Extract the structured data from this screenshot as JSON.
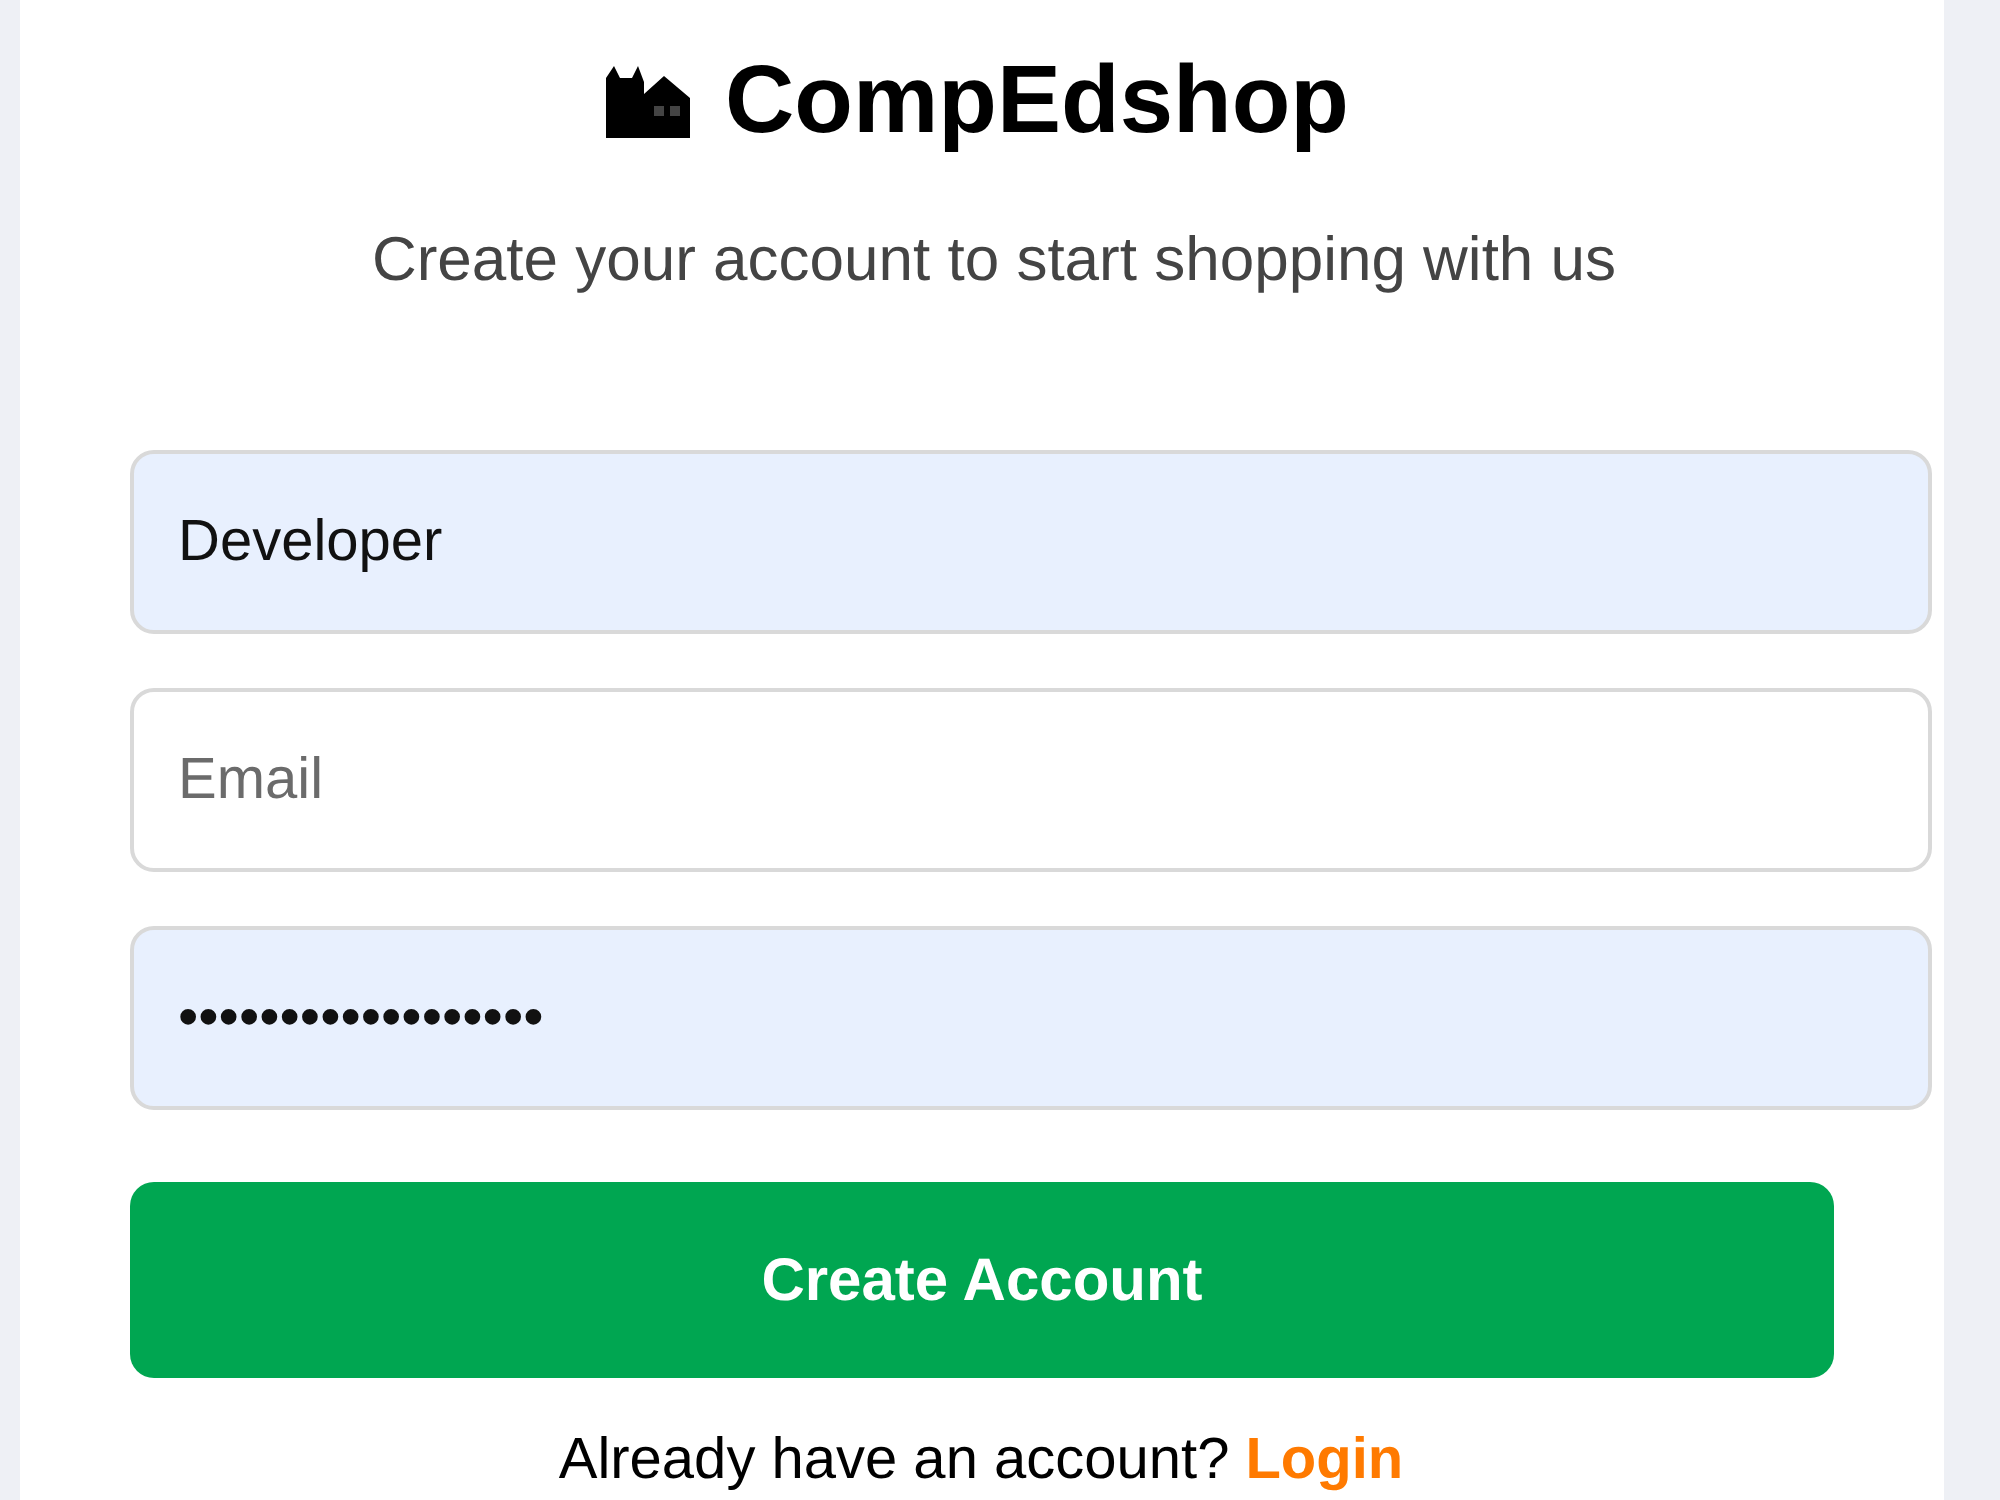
{
  "brand": {
    "name": "CompEdshop"
  },
  "subtitle": "Create your account to start shopping with us",
  "fields": [
    {
      "value": "Developer",
      "autofilled": true
    },
    {
      "placeholder": "Email",
      "autofilled": false
    },
    {
      "value": "••••••••••••••••••",
      "autofilled": true
    }
  ],
  "submit_button": {
    "label": "Create Account"
  },
  "footer": {
    "text": "Already have an account?",
    "link": "Login"
  }
}
